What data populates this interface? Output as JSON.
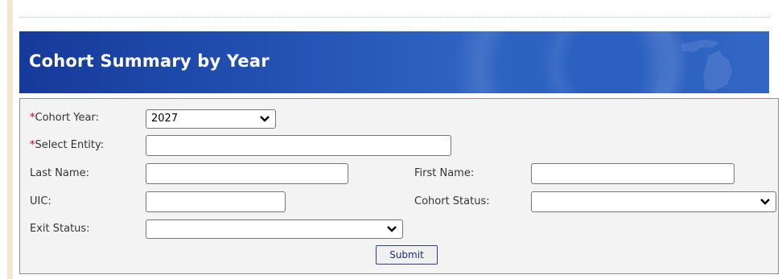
{
  "page": {
    "title": "Cohort Summary by Year"
  },
  "form": {
    "cohort_year": {
      "label": "Cohort Year:",
      "required_mark": "*",
      "value": "2027"
    },
    "select_entity": {
      "label": "Select Entity:",
      "required_mark": "*",
      "value": ""
    },
    "last_name": {
      "label": "Last Name:",
      "value": ""
    },
    "first_name": {
      "label": "First Name:",
      "value": ""
    },
    "uic": {
      "label": "UIC:",
      "value": ""
    },
    "cohort_status": {
      "label": "Cohort Status:",
      "value": ""
    },
    "exit_status": {
      "label": "Exit Status:",
      "value": ""
    },
    "submit_label": "Submit"
  },
  "colors": {
    "banner": "#2352b3",
    "required": "#cc0000",
    "panel_background": "#f3f3f3"
  }
}
